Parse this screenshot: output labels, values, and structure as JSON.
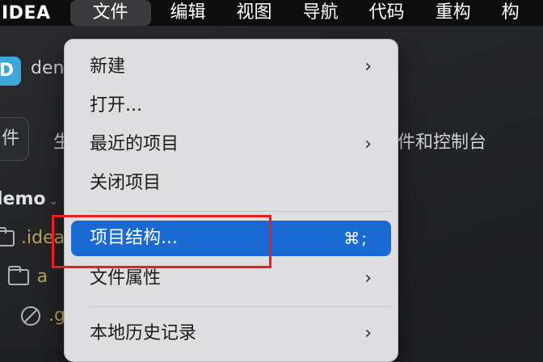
{
  "menubar": {
    "app": "IDEA",
    "items": [
      "文件",
      "编辑",
      "视图",
      "导航",
      "代码",
      "重构",
      "构"
    ]
  },
  "background": {
    "project_badge": "D",
    "project_name": "den",
    "toolbar_chip": "件",
    "toolbar_left_text": "生",
    "toolbar_right_text": "件和控制台",
    "tree_root": "lemo",
    "tree_root_chevron": "⌄",
    "rows": [
      {
        "label": ".idea"
      },
      {
        "label": "a"
      },
      {
        "label": ".g"
      }
    ]
  },
  "file_menu": {
    "items": [
      {
        "label": "新建",
        "submenu": true
      },
      {
        "label": "打开..."
      },
      {
        "label": "最近的项目",
        "submenu": true
      },
      {
        "label": "关闭项目"
      },
      {
        "label": "项目结构...",
        "shortcut": "⌘;",
        "highlighted": true
      },
      {
        "label": "文件属性",
        "submenu": true
      },
      {
        "label": "本地历史记录",
        "submenu": true
      }
    ],
    "chevron": "›"
  },
  "colors": {
    "highlight": "#1a6ad4",
    "annotation": "#ef1e1e",
    "project_badge": "#3ba8d8"
  }
}
